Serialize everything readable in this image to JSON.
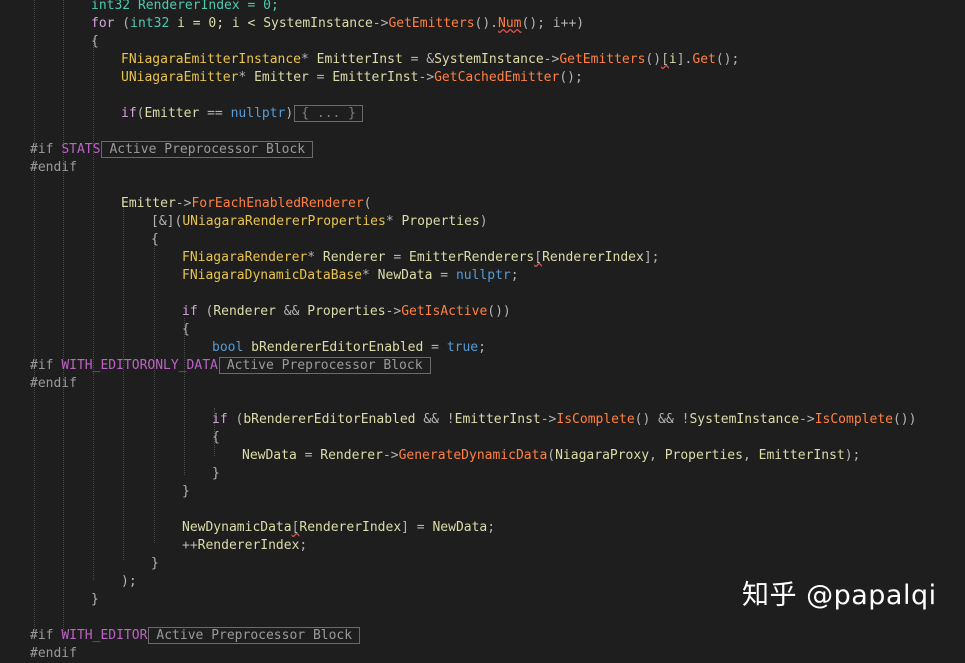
{
  "code_lines": [
    {
      "tokens": [
        {
          "t": "int32 RendererIndex = 0;",
          "c": "t-type"
        }
      ]
    },
    {
      "tokens": [
        {
          "t": "for",
          "c": "t-ctl"
        },
        {
          "t": " (",
          "c": "t-op"
        },
        {
          "t": "int32",
          "c": "t-type"
        },
        {
          "t": " i = 0; i < ",
          "c": "t-var"
        },
        {
          "t": "SystemInstance",
          "c": "t-var"
        },
        {
          "t": "->",
          "c": "t-op"
        },
        {
          "t": "GetEmitters",
          "c": "t-fn"
        },
        {
          "t": "().",
          "c": "t-op"
        },
        {
          "t": "Num",
          "c": "t-fn squiggle"
        },
        {
          "t": "(); i++)",
          "c": "t-op"
        }
      ]
    },
    {
      "tokens": [
        {
          "t": "{",
          "c": "t-op"
        }
      ]
    },
    {
      "tokens": [
        {
          "t": "FNiagaraEmitterInstance",
          "c": "t-ue"
        },
        {
          "t": "* ",
          "c": "t-op"
        },
        {
          "t": "EmitterInst",
          "c": "t-var"
        },
        {
          "t": " = &",
          "c": "t-op"
        },
        {
          "t": "SystemInstance",
          "c": "t-var"
        },
        {
          "t": "->",
          "c": "t-op"
        },
        {
          "t": "GetEmitters",
          "c": "t-fn"
        },
        {
          "t": "()",
          "c": "t-op"
        },
        {
          "t": "[",
          "c": "t-op squiggle"
        },
        {
          "t": "i",
          "c": "t-var"
        },
        {
          "t": "].",
          "c": "t-op"
        },
        {
          "t": "Get",
          "c": "t-fn"
        },
        {
          "t": "();",
          "c": "t-op"
        }
      ]
    },
    {
      "tokens": [
        {
          "t": "UNiagaraEmitter",
          "c": "t-ue"
        },
        {
          "t": "* ",
          "c": "t-op"
        },
        {
          "t": "Emitter",
          "c": "t-var"
        },
        {
          "t": " = ",
          "c": "t-op"
        },
        {
          "t": "EmitterInst",
          "c": "t-var"
        },
        {
          "t": "->",
          "c": "t-op"
        },
        {
          "t": "GetCachedEmitter",
          "c": "t-fn"
        },
        {
          "t": "();",
          "c": "t-op"
        }
      ]
    },
    {
      "tokens": []
    },
    {
      "tokens": [
        {
          "t": "if",
          "c": "t-ctl"
        },
        {
          "t": "(",
          "c": "t-op"
        },
        {
          "t": "Emitter",
          "c": "t-var"
        },
        {
          "t": " == ",
          "c": "t-op"
        },
        {
          "t": "nullptr",
          "c": "t-blue"
        },
        {
          "t": ")",
          "c": "t-op"
        },
        {
          "t": "{ ... }",
          "c": "collapsed"
        }
      ]
    },
    {
      "tokens": []
    },
    {
      "tokens": [
        {
          "t": "#if ",
          "c": "t-pp"
        },
        {
          "t": "STATS",
          "c": "t-macro"
        },
        {
          "t": "Active Preprocessor Block",
          "c": "ppblock"
        }
      ]
    },
    {
      "tokens": [
        {
          "t": "#endif",
          "c": "t-pp"
        }
      ]
    },
    {
      "tokens": []
    },
    {
      "tokens": [
        {
          "t": "Emitter",
          "c": "t-var"
        },
        {
          "t": "->",
          "c": "t-op"
        },
        {
          "t": "ForEachEnabledRenderer",
          "c": "t-fn"
        },
        {
          "t": "(",
          "c": "t-op"
        }
      ]
    },
    {
      "tokens": [
        {
          "t": "[&](",
          "c": "t-op"
        },
        {
          "t": "UNiagaraRendererProperties",
          "c": "t-ue"
        },
        {
          "t": "* ",
          "c": "t-op"
        },
        {
          "t": "Properties",
          "c": "t-var"
        },
        {
          "t": ")",
          "c": "t-op"
        }
      ]
    },
    {
      "tokens": [
        {
          "t": "{",
          "c": "t-op"
        }
      ]
    },
    {
      "tokens": [
        {
          "t": "FNiagaraRenderer",
          "c": "t-ue"
        },
        {
          "t": "* ",
          "c": "t-op"
        },
        {
          "t": "Renderer",
          "c": "t-var"
        },
        {
          "t": " = ",
          "c": "t-op"
        },
        {
          "t": "EmitterRenderers",
          "c": "t-var"
        },
        {
          "t": "[",
          "c": "t-op squiggle"
        },
        {
          "t": "RendererIndex",
          "c": "t-var"
        },
        {
          "t": "];",
          "c": "t-op"
        }
      ]
    },
    {
      "tokens": [
        {
          "t": "FNiagaraDynamicDataBase",
          "c": "t-ue"
        },
        {
          "t": "* ",
          "c": "t-op"
        },
        {
          "t": "NewData",
          "c": "t-var"
        },
        {
          "t": " = ",
          "c": "t-op"
        },
        {
          "t": "nullptr",
          "c": "t-blue"
        },
        {
          "t": ";",
          "c": "t-op"
        }
      ]
    },
    {
      "tokens": []
    },
    {
      "tokens": [
        {
          "t": "if",
          "c": "t-ctl"
        },
        {
          "t": " (",
          "c": "t-op"
        },
        {
          "t": "Renderer",
          "c": "t-var"
        },
        {
          "t": " && ",
          "c": "t-op"
        },
        {
          "t": "Properties",
          "c": "t-var"
        },
        {
          "t": "->",
          "c": "t-op"
        },
        {
          "t": "GetIsActive",
          "c": "t-fn"
        },
        {
          "t": "())",
          "c": "t-op"
        }
      ]
    },
    {
      "tokens": [
        {
          "t": "{",
          "c": "t-op"
        }
      ]
    },
    {
      "tokens": [
        {
          "t": "bool",
          "c": "t-blue"
        },
        {
          "t": " ",
          "c": "t-op"
        },
        {
          "t": "bRendererEditorEnabled",
          "c": "t-var"
        },
        {
          "t": " = ",
          "c": "t-op"
        },
        {
          "t": "true",
          "c": "t-blue"
        },
        {
          "t": ";",
          "c": "t-op"
        }
      ]
    },
    {
      "tokens": [
        {
          "t": "#if ",
          "c": "t-pp"
        },
        {
          "t": "WITH_EDITORONLY_DATA",
          "c": "t-macro"
        },
        {
          "t": "Active Preprocessor Block",
          "c": "ppblock"
        }
      ]
    },
    {
      "tokens": [
        {
          "t": "#endif",
          "c": "t-pp"
        }
      ]
    },
    {
      "tokens": []
    },
    {
      "tokens": [
        {
          "t": "if",
          "c": "t-ctl"
        },
        {
          "t": " (",
          "c": "t-op"
        },
        {
          "t": "bRendererEditorEnabled",
          "c": "t-var"
        },
        {
          "t": " && !",
          "c": "t-op"
        },
        {
          "t": "EmitterInst",
          "c": "t-var"
        },
        {
          "t": "->",
          "c": "t-op"
        },
        {
          "t": "IsComplete",
          "c": "t-fn"
        },
        {
          "t": "() && !",
          "c": "t-op"
        },
        {
          "t": "SystemInstance",
          "c": "t-var"
        },
        {
          "t": "->",
          "c": "t-op"
        },
        {
          "t": "IsComplete",
          "c": "t-fn"
        },
        {
          "t": "())",
          "c": "t-op"
        }
      ]
    },
    {
      "tokens": [
        {
          "t": "{",
          "c": "t-op"
        }
      ]
    },
    {
      "tokens": [
        {
          "t": "NewData",
          "c": "t-var"
        },
        {
          "t": " = ",
          "c": "t-op"
        },
        {
          "t": "Renderer",
          "c": "t-var"
        },
        {
          "t": "->",
          "c": "t-op"
        },
        {
          "t": "GenerateDynamicData",
          "c": "t-fn"
        },
        {
          "t": "(",
          "c": "t-op"
        },
        {
          "t": "NiagaraProxy",
          "c": "t-var"
        },
        {
          "t": ", ",
          "c": "t-op"
        },
        {
          "t": "Properties",
          "c": "t-var"
        },
        {
          "t": ", ",
          "c": "t-op"
        },
        {
          "t": "EmitterInst",
          "c": "t-var"
        },
        {
          "t": ");",
          "c": "t-op"
        }
      ]
    },
    {
      "tokens": [
        {
          "t": "}",
          "c": "t-op"
        }
      ]
    },
    {
      "tokens": [
        {
          "t": "}",
          "c": "t-op"
        }
      ]
    },
    {
      "tokens": []
    },
    {
      "tokens": [
        {
          "t": "NewDynamicData",
          "c": "t-var"
        },
        {
          "t": "[",
          "c": "t-op squiggle"
        },
        {
          "t": "RendererIndex",
          "c": "t-var"
        },
        {
          "t": "] = ",
          "c": "t-op"
        },
        {
          "t": "NewData",
          "c": "t-var"
        },
        {
          "t": ";",
          "c": "t-op"
        }
      ]
    },
    {
      "tokens": [
        {
          "t": "++",
          "c": "t-op"
        },
        {
          "t": "RendererIndex",
          "c": "t-var"
        },
        {
          "t": ";",
          "c": "t-op"
        }
      ]
    },
    {
      "tokens": [
        {
          "t": "}",
          "c": "t-op"
        }
      ]
    },
    {
      "tokens": [
        {
          "t": ");",
          "c": "t-op"
        }
      ]
    },
    {
      "tokens": [
        {
          "t": "}",
          "c": "t-op"
        }
      ]
    },
    {
      "tokens": []
    },
    {
      "tokens": [
        {
          "t": "#if ",
          "c": "t-pp"
        },
        {
          "t": "WITH_EDITOR",
          "c": "t-macro"
        },
        {
          "t": "Active Preprocessor Block",
          "c": "ppblock"
        }
      ]
    },
    {
      "tokens": [
        {
          "t": "#endif",
          "c": "t-pp"
        }
      ]
    }
  ],
  "watermark": {
    "text": "知乎 @papalqi"
  }
}
